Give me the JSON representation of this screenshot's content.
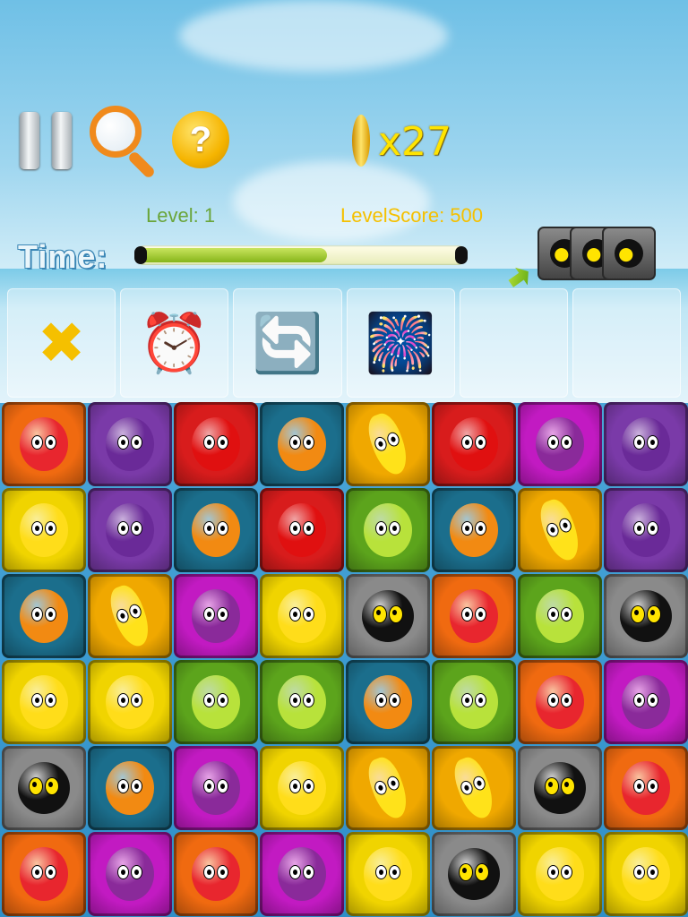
{
  "header": {
    "coins_count": "x27",
    "level_label": "Level:  1",
    "level_score_label": "LevelScore:  500",
    "time_label": "Time:",
    "time_progress": 0.59,
    "bomb_stack_count": 3
  },
  "icons": {
    "pause": "pause-icon",
    "hint": "magnifier-icon",
    "help": "question-coin-icon",
    "coin": "coin-icon"
  },
  "powerups": [
    {
      "name": "crossed-coins-icon",
      "glyph": "✖"
    },
    {
      "name": "alarm-clock-icon",
      "glyph": "⏰"
    },
    {
      "name": "shuffle-arrows-icon",
      "glyph": "🔄"
    },
    {
      "name": "fireworks-rockets-icon",
      "glyph": "🎆"
    },
    {
      "name": "empty-slot",
      "glyph": ""
    },
    {
      "name": "empty-slot",
      "glyph": ""
    }
  ],
  "tile_colors": {
    "strawberry": "#f06a10",
    "plum": "#7a3aa8",
    "apple": "#d81c1c",
    "orange": "#1b6e8c",
    "banana": "#f0a800",
    "grape": "#c21ac2",
    "pineapple": "#f0d400",
    "lime": "#5ca41c",
    "bomb": "#8a8a8a"
  },
  "grid": [
    [
      "strawberry",
      "plum",
      "apple",
      "orange",
      "banana",
      "apple",
      "grape",
      "plum"
    ],
    [
      "pineapple",
      "plum",
      "orange",
      "apple",
      "lime",
      "orange",
      "banana",
      "plum"
    ],
    [
      "orange",
      "banana",
      "grape",
      "pineapple",
      "bomb",
      "strawberry",
      "lime",
      "bomb"
    ],
    [
      "pineapple",
      "pineapple",
      "lime",
      "lime",
      "orange",
      "lime",
      "strawberry",
      "grape"
    ],
    [
      "bomb",
      "orange",
      "grape",
      "pineapple",
      "banana",
      "banana",
      "bomb",
      "strawberry"
    ],
    [
      "strawberry",
      "grape",
      "strawberry",
      "grape",
      "pineapple",
      "bomb",
      "pineapple",
      "pineapple"
    ]
  ]
}
